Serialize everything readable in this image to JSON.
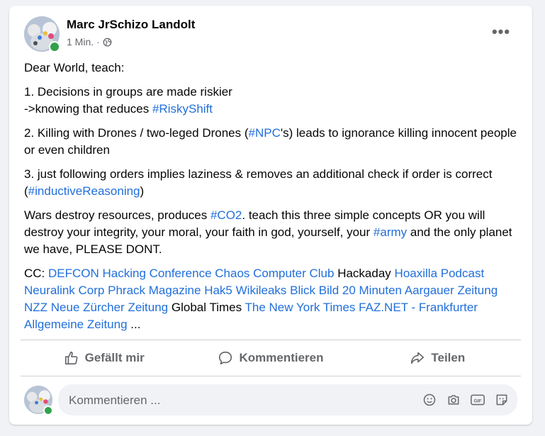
{
  "post": {
    "author": "Marc JrSchizo Landolt",
    "time": "1 Min.",
    "separator": "·",
    "menu_label": "•••",
    "body": {
      "p1": "Dear World, teach:",
      "p2_line1": "1. Decisions in groups are made riskier",
      "p2_line2_prefix": "->knowing that reduces ",
      "p2_tag": "#RiskyShift",
      "p3_prefix": "2. Killing with Drones / two-leged Drones (",
      "p3_tag": "#NPC",
      "p3_suffix": "'s) leads to ignorance killing innocent people or even children",
      "p4_prefix": "3. just following orders implies laziness & removes an additional check if order is correct (",
      "p4_tag": "#inductiveReasoning",
      "p4_suffix": ")",
      "p5_prefix": "Wars destroy resources, produces ",
      "p5_tag1": "#CO2",
      "p5_mid": ". teach this three simple concepts OR you will destroy your integrity, your moral, your faith in god, yourself, your ",
      "p5_tag2": "#army",
      "p5_suffix": " and the only planet we have, PLEASE DONT.",
      "cc_prefix": "CC: ",
      "cc": [
        {
          "text": "DEFCON Hacking Conference",
          "link": true
        },
        {
          "text": "Chaos Computer Club",
          "link": true
        },
        {
          "text": "Hackaday",
          "link": false
        },
        {
          "text": "Hoaxilla Podcast",
          "link": true
        },
        {
          "text": "Neuralink Corp",
          "link": true
        },
        {
          "text": "Phrack Magazine",
          "link": true
        },
        {
          "text": "Hak5",
          "link": true
        },
        {
          "text": "Wikileaks",
          "link": true
        },
        {
          "text": "Blick",
          "link": true
        },
        {
          "text": "Bild",
          "link": true
        },
        {
          "text": "20 Minuten",
          "link": true
        },
        {
          "text": "Aargauer Zeitung",
          "link": true
        },
        {
          "text": "NZZ",
          "link": true
        },
        {
          "text": "Neue Zürcher Zeitung",
          "link": true
        },
        {
          "text": "Global Times",
          "link": false
        },
        {
          "text": "The New York Times",
          "link": true
        },
        {
          "text": "FAZ.NET - Frankfurter Allgemeine Zeitung",
          "link": true
        }
      ],
      "cc_suffix": " ..."
    }
  },
  "actions": {
    "like": "Gefällt mir",
    "comment": "Kommentieren",
    "share": "Teilen"
  },
  "comment_input": {
    "placeholder": "Kommentieren ...",
    "icons": [
      "emoji-icon",
      "camera-icon",
      "gif-icon",
      "sticker-icon"
    ]
  },
  "colors": {
    "link": "#216fdb",
    "muted": "#65676b",
    "online": "#31a24c"
  }
}
